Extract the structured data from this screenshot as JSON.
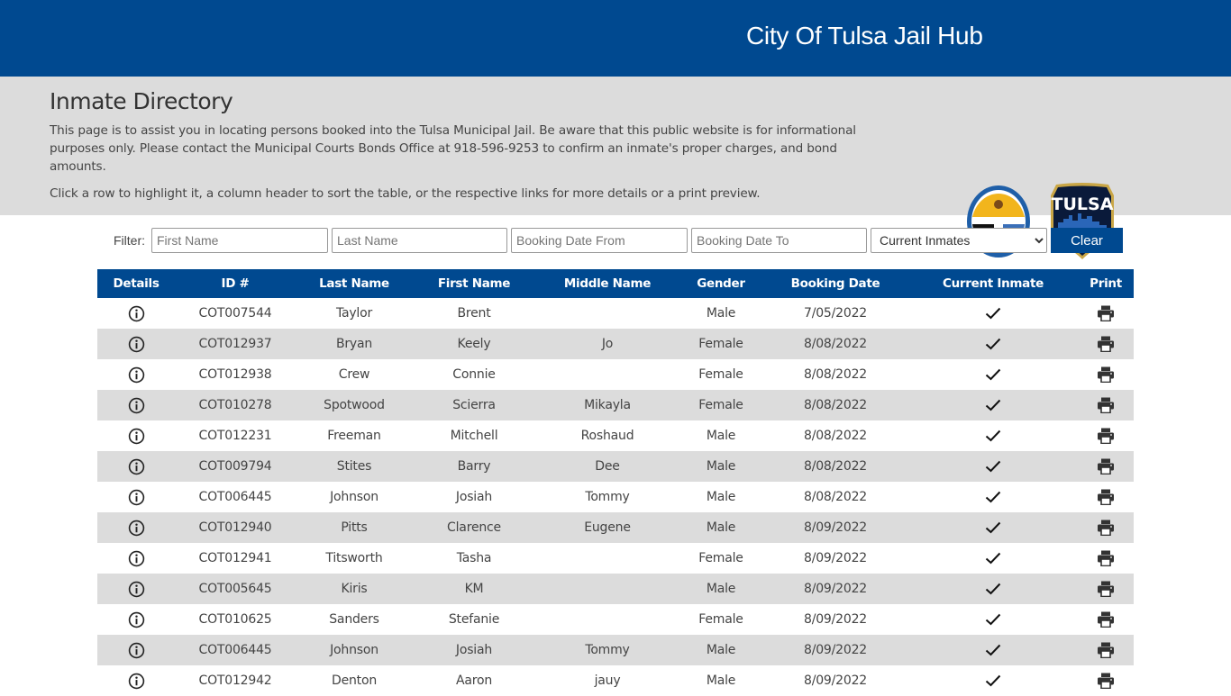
{
  "header": {
    "site_title": "City Of Tulsa Jail Hub"
  },
  "intro": {
    "title": "Inmate Directory",
    "paragraph1": "This page is to assist you in locating persons booked into the Tulsa Municipal Jail. Be aware that this public website is for informational purposes only. Please contact the Municipal Courts Bonds Office at 918-596-9253 to confirm an inmate's proper charges, and bond amounts.",
    "paragraph2": "Click a row to highlight it, a column header to sort the table, or the respective links for more details or a print preview.",
    "logos": [
      "city-of-tulsa-seal",
      "tulsa-police-badge"
    ]
  },
  "filter": {
    "label": "Filter:",
    "first_name_placeholder": "First Name",
    "last_name_placeholder": "Last Name",
    "booking_from_placeholder": "Booking Date From",
    "booking_to_placeholder": "Booking Date To",
    "status_selected": "Current Inmates",
    "clear_label": "Clear"
  },
  "colors": {
    "brand": "#004990",
    "band": "#dcdcdc"
  },
  "table": {
    "columns": [
      "Details",
      "ID #",
      "Last Name",
      "First Name",
      "Middle Name",
      "Gender",
      "Booking Date",
      "Current Inmate",
      "Print"
    ],
    "rows": [
      {
        "id": "COT007544",
        "last": "Taylor",
        "first": "Brent",
        "middle": "",
        "gender": "Male",
        "date": "7/05/2022",
        "current": true
      },
      {
        "id": "COT012937",
        "last": "Bryan",
        "first": "Keely",
        "middle": "Jo",
        "gender": "Female",
        "date": "8/08/2022",
        "current": true
      },
      {
        "id": "COT012938",
        "last": "Crew",
        "first": "Connie",
        "middle": "",
        "gender": "Female",
        "date": "8/08/2022",
        "current": true
      },
      {
        "id": "COT010278",
        "last": "Spotwood",
        "first": "Scierra",
        "middle": "Mikayla",
        "gender": "Female",
        "date": "8/08/2022",
        "current": true
      },
      {
        "id": "COT012231",
        "last": "Freeman",
        "first": "Mitchell",
        "middle": "Roshaud",
        "gender": "Male",
        "date": "8/08/2022",
        "current": true
      },
      {
        "id": "COT009794",
        "last": "Stites",
        "first": "Barry",
        "middle": "Dee",
        "gender": "Male",
        "date": "8/08/2022",
        "current": true
      },
      {
        "id": "COT006445",
        "last": "Johnson",
        "first": "Josiah",
        "middle": "Tommy",
        "gender": "Male",
        "date": "8/08/2022",
        "current": true
      },
      {
        "id": "COT012940",
        "last": "Pitts",
        "first": "Clarence",
        "middle": "Eugene",
        "gender": "Male",
        "date": "8/09/2022",
        "current": true
      },
      {
        "id": "COT012941",
        "last": "Titsworth",
        "first": "Tasha",
        "middle": "",
        "gender": "Female",
        "date": "8/09/2022",
        "current": true
      },
      {
        "id": "COT005645",
        "last": "Kiris",
        "first": "KM",
        "middle": "",
        "gender": "Male",
        "date": "8/09/2022",
        "current": true
      },
      {
        "id": "COT010625",
        "last": "Sanders",
        "first": "Stefanie",
        "middle": "",
        "gender": "Female",
        "date": "8/09/2022",
        "current": true
      },
      {
        "id": "COT006445",
        "last": "Johnson",
        "first": "Josiah",
        "middle": "Tommy",
        "gender": "Male",
        "date": "8/09/2022",
        "current": true
      },
      {
        "id": "COT012942",
        "last": "Denton",
        "first": "Aaron",
        "middle": "jauy",
        "gender": "Male",
        "date": "8/09/2022",
        "current": true
      }
    ]
  }
}
